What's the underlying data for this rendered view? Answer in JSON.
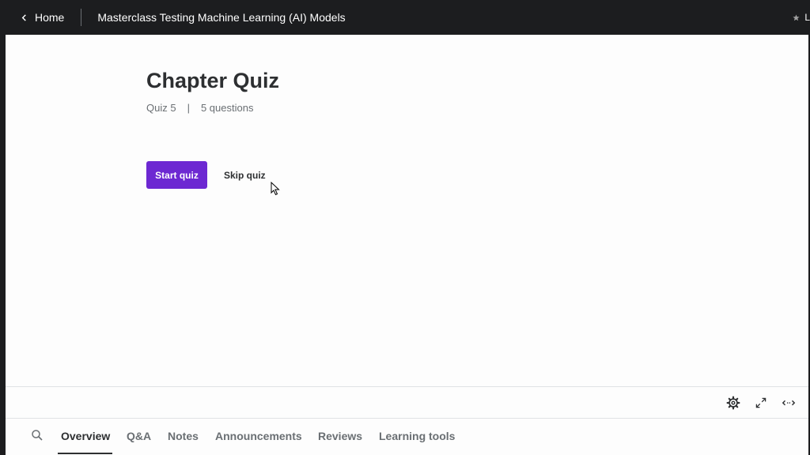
{
  "header": {
    "home_label": "Home",
    "course_title": "Masterclass Testing Machine Learning (AI) Models",
    "right_label": "L"
  },
  "quiz": {
    "title": "Chapter Quiz",
    "number": "Quiz 5",
    "separator": "|",
    "questions": "5 questions",
    "start_label": "Start quiz",
    "skip_label": "Skip quiz"
  },
  "tabs": [
    {
      "label": "Overview"
    },
    {
      "label": "Q&A"
    },
    {
      "label": "Notes"
    },
    {
      "label": "Announcements"
    },
    {
      "label": "Reviews"
    },
    {
      "label": "Learning tools"
    }
  ],
  "active_tab": "Overview",
  "colors": {
    "accent": "#6d28d2",
    "header_bg": "#1c1d1f",
    "panel_bg": "#fdfdfd"
  },
  "icons": {
    "back": "chevron-left-icon",
    "star": "star-icon",
    "settings": "gear-icon",
    "fullscreen": "expand-icon",
    "theater": "arrows-horizontal-icon",
    "search": "search-icon"
  }
}
